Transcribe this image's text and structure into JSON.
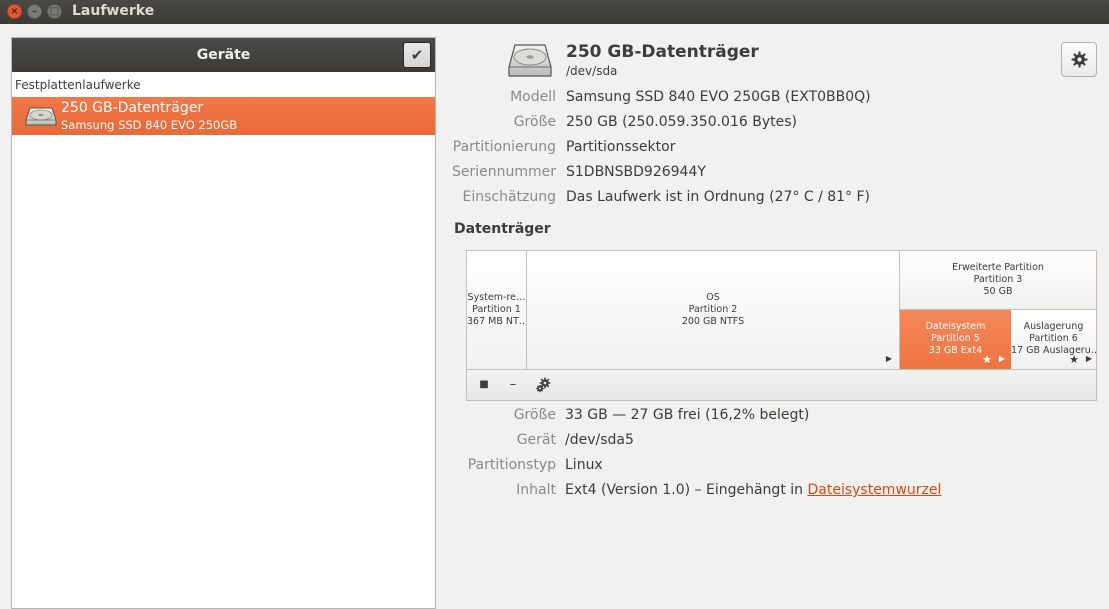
{
  "window": {
    "title": "Laufwerke",
    "close_glyph": "×",
    "min_glyph": "–",
    "max_glyph": "□"
  },
  "sidebar": {
    "header": "Geräte",
    "check_glyph": "✔",
    "section": "Festplattenlaufwerke",
    "items": [
      {
        "title": "250 GB-Datenträger",
        "subtitle": "Samsung SSD 840 EVO 250GB",
        "icon": "hard-disk-icon",
        "selected": true
      }
    ]
  },
  "drive": {
    "title": "250 GB-Datenträger",
    "device": "/dev/sda",
    "icon": "hard-disk-icon",
    "properties": [
      {
        "label": "Modell",
        "value": "Samsung SSD 840 EVO 250GB (EXT0BB0Q)"
      },
      {
        "label": "Größe",
        "value": "250 GB (250.059.350.016 Bytes)"
      },
      {
        "label": "Partitionierung",
        "value": "Partitionssektor"
      },
      {
        "label": "Seriennummer",
        "value": "S1DBNSBD926944Y"
      },
      {
        "label": "Einschätzung",
        "value": "Das Laufwerk ist in Ordnung (27° C / 81° F)"
      }
    ]
  },
  "volumes": {
    "section_title": "Datenträger",
    "partitions": [
      {
        "name": "System-re…",
        "number": "Partition 1",
        "info": "367 MB NT…"
      },
      {
        "name": "OS",
        "number": "Partition 2",
        "info": "200 GB NTFS"
      },
      {
        "name": "Erweiterte Partition",
        "number": "Partition 3",
        "info": "50 GB"
      },
      {
        "name": "Dateisystem",
        "number": "Partition 5",
        "info": "33 GB Ext4",
        "selected": true
      },
      {
        "name": "Auslagerung",
        "number": "Partition 6",
        "info": "17 GB Auslageru…"
      }
    ],
    "play_glyph": "▶",
    "star_glyph": "★",
    "tools": {
      "stop_glyph": "■",
      "remove_glyph": "–"
    }
  },
  "selected_partition": {
    "size_label": "Größe",
    "size_value": "33 GB — 27 GB frei (16,2% belegt)",
    "device_label": "Gerät",
    "device_value": "/dev/sda5",
    "type_label": "Partitionstyp",
    "type_value": "Linux",
    "content_label": "Inhalt",
    "content_prefix": "Ext4 (Version 1.0) – Eingehängt in ",
    "content_link": "Dateisystemwurzel"
  },
  "colors": {
    "accent": "#ea6937",
    "titlebar": "#3c3b37",
    "link": "#dd4814"
  }
}
